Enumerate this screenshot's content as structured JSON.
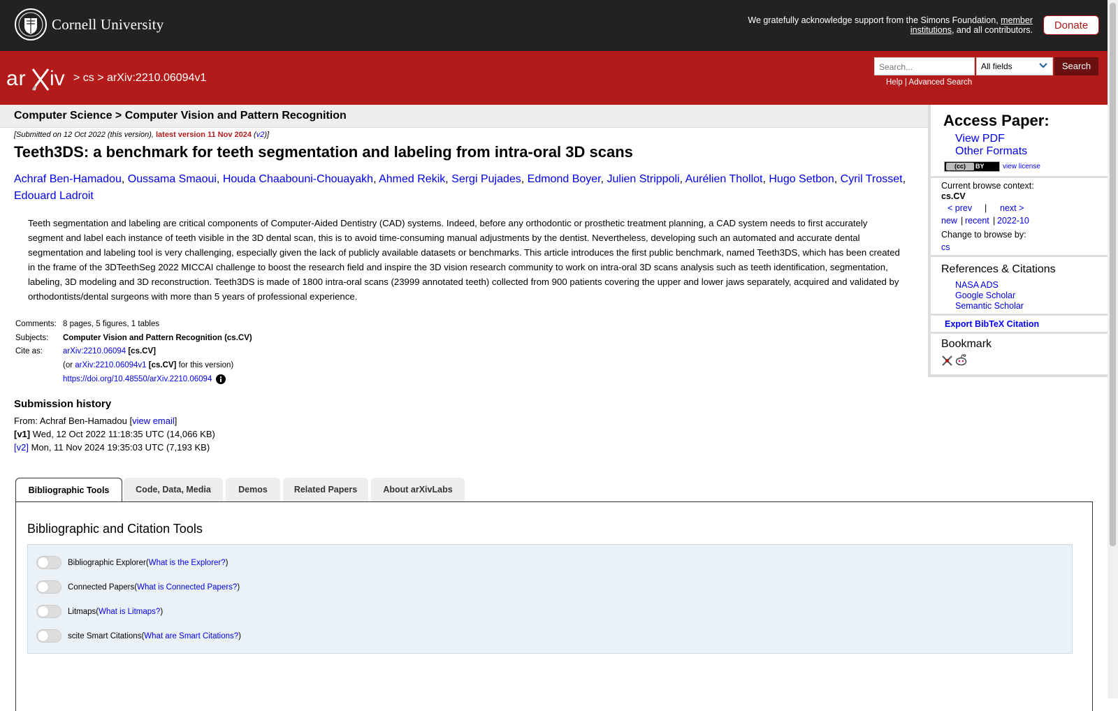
{
  "topbar": {
    "university": "Cornell University",
    "support_prefix": "We gratefully acknowledge support from the Simons Foundation, ",
    "support_link": "member institutions",
    "support_suffix": ", and all contributors.",
    "donate_label": "Donate"
  },
  "header": {
    "logo": "arXiv",
    "breadcrumb": "> cs > arXiv:2210.06094v1",
    "search_placeholder": "Search...",
    "search_field": "All fields",
    "search_button": "Search",
    "help_link": "Help",
    "separator": "|",
    "advanced_link": "Advanced Search"
  },
  "subheader": "Computer Science > Computer Vision and Pattern Recognition",
  "dateline": {
    "prefix": "[Submitted on 12 Oct 2022 (this version), ",
    "latest": "latest version 11 Nov 2024",
    "open": " (",
    "v2": "v2",
    "close": ")]"
  },
  "title": "Teeth3DS: a benchmark for teeth segmentation and labeling from intra-oral 3D scans",
  "authors": [
    "Achraf Ben-Hamadou",
    "Oussama Smaoui",
    "Houda Chaabouni-Chouayakh",
    "Ahmed Rekik",
    "Sergi Pujades",
    "Edmond Boyer",
    "Julien Strippoli",
    "Aurélien Thollot",
    "Hugo Setbon",
    "Cyril Trosset",
    "Edouard Ladroit"
  ],
  "abstract": "Teeth segmentation and labeling are critical components of Computer-Aided Dentistry (CAD) systems. Indeed, before any orthodontic or prosthetic treatment planning, a CAD system needs to first accurately segment and label each instance of teeth visible in the 3D dental scan, this is to avoid time-consuming manual adjustments by the dentist. Nevertheless, developing such an automated and accurate dental segmentation and labeling tool is very challenging, especially given the lack of publicly available datasets or benchmarks. This article introduces the first public benchmark, named Teeth3DS, which has been created in the frame of the 3DTeethSeg 2022 MICCAI challenge to boost the research field and inspire the 3D vision research community to work on intra-oral 3D scans analysis such as teeth identification, segmentation, labeling, 3D modeling and 3D reconstruction. Teeth3DS is made of 1800 intra-oral scans (23999 annotated teeth) collected from 900 patients covering the upper and lower jaws separately, acquired and validated by orthodontists/dental surgeons with more than 5 years of professional experience.",
  "meta": {
    "comments_label": "Comments:",
    "comments": "8 pages, 5 figures, 1 tables",
    "subjects_label": "Subjects:",
    "subjects": "Computer Vision and Pattern Recognition (cs.CV)",
    "cite_label": "Cite as:",
    "cite_id": "arXiv:2210.06094",
    "cite_cat": " [cs.CV]",
    "or_prefix": "(or ",
    "version_id": "arXiv:2210.06094v1",
    "version_cat": " [cs.CV]",
    "version_suffix": " for this version)",
    "doi": "https://doi.org/10.48550/arXiv.2210.06094"
  },
  "history": {
    "title": "Submission history",
    "from_prefix": "From: Achraf Ben-Hamadou [",
    "view_email": "view email",
    "from_suffix": "]",
    "v1_label": "[v1]",
    "v1_text": " Wed, 12 Oct 2022 11:18:35 UTC (14,066 KB)",
    "v2_label": "[v2]",
    "v2_text": " Mon, 11 Nov 2024 19:35:03 UTC (7,193 KB)"
  },
  "sidebar": {
    "access_title": "Access Paper:",
    "view_pdf": "View PDF",
    "other_formats": "Other Formats",
    "cc_label": "(cc)",
    "by_label": "BY",
    "view_license": "view license",
    "browse_context_label": "Current browse context:",
    "browse_context": "cs.CV",
    "prev": "< prev",
    "pipe": "|",
    "next": "next >",
    "new": "new",
    "recent": "recent",
    "month": "2022-10",
    "change_browse": "Change to browse by:",
    "cs": "cs",
    "refs_title": "References & Citations",
    "nasa": "NASA ADS",
    "google": "Google Scholar",
    "semantic": "Semantic Scholar",
    "export_bibtex": "Export BibTeX Citation",
    "bookmark_title": "Bookmark"
  },
  "tabs": [
    "Bibliographic Tools",
    "Code, Data, Media",
    "Demos",
    "Related Papers",
    "About arXivLabs"
  ],
  "panel": {
    "title": "Bibliographic and Citation Tools",
    "tools": [
      {
        "name": "Bibliographic Explorer",
        "link": "What is the Explorer?"
      },
      {
        "name": "Connected Papers",
        "link": "What is Connected Papers?"
      },
      {
        "name": "Litmaps",
        "link": "What is Litmaps?"
      },
      {
        "name": "scite Smart Citations",
        "link": "What are Smart Citations?"
      }
    ],
    "paren_open": " (",
    "paren_close": ")"
  },
  "colors": {
    "brand_red": "#b31b1b",
    "link": "#0000ee",
    "topbar": "#222222"
  }
}
